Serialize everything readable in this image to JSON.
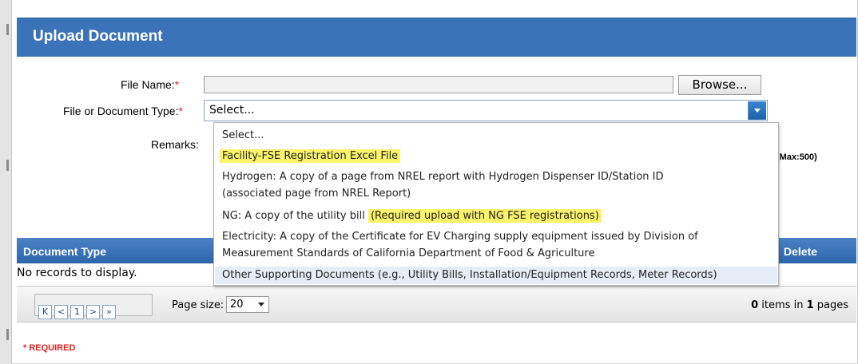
{
  "header": {
    "title": "Upload Document"
  },
  "form": {
    "file_name_label": "File Name:",
    "doc_type_label": "File or Document Type:",
    "remarks_label": "Remarks:",
    "required_marker": "*",
    "browse_label": "Browse...",
    "doc_type_selected": "Select...",
    "max_note": "(Max:500)"
  },
  "dropdown": {
    "options": [
      {
        "text": "Select...",
        "highlight": ""
      },
      {
        "text": "",
        "highlight": "Facility-FSE Registration Excel File"
      },
      {
        "text": "Hydrogen: A copy of a page from NREL report with Hydrogen Dispenser ID/Station ID",
        "highlight": ""
      },
      {
        "text": "(associated page from NREL Report)",
        "highlight": ""
      },
      {
        "text": "NG: A copy of the utility bill ",
        "highlight": "(Required upload with NG FSE registrations)"
      },
      {
        "text": "Electricity: A copy of the Certificate for EV Charging supply equipment issued by Division of",
        "highlight": ""
      },
      {
        "text": "Measurement Standards of California Department of Food & Agriculture",
        "highlight": ""
      },
      {
        "text": "Other Supporting Documents (e.g., Utility Bills, Installation/Equipment Records, Meter Records)",
        "highlight": ""
      }
    ]
  },
  "grid": {
    "col_document_type": "Document Type",
    "col_delete": "Delete",
    "empty_text": "No records to display."
  },
  "pager": {
    "first": "K",
    "prev": "<",
    "page": "1",
    "next": ">",
    "last": "»",
    "page_size_label": "Page size:",
    "page_size_value": "20",
    "items_count": "0",
    "items_text_1": " items in ",
    "pages_count": "1",
    "items_text_2": " pages"
  },
  "footer": {
    "required_note": "* REQUIRED"
  },
  "colors": {
    "header_blue": "#3b73b9",
    "highlight_yellow": "#fbf36a",
    "required_red": "#e02020"
  }
}
